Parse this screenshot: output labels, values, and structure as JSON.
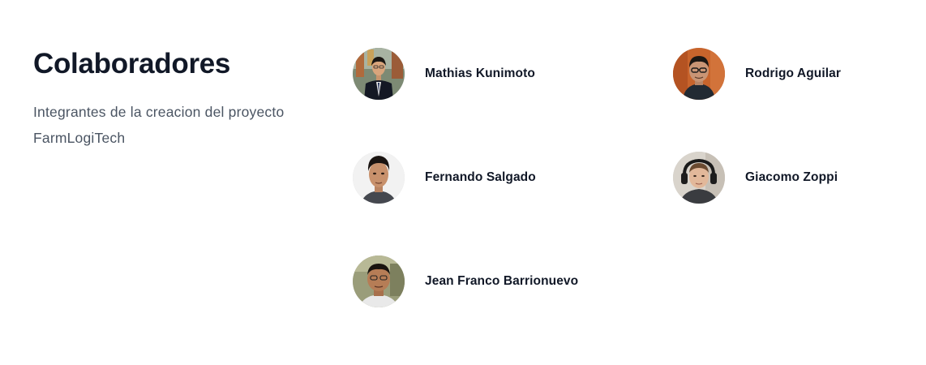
{
  "section": {
    "title": "Colaboradores",
    "description": "Integrantes de la creacion del proyecto FarmLogiTech"
  },
  "members": [
    {
      "name": "Mathias Kunimoto",
      "avatar_icon": "user-photo-avatar"
    },
    {
      "name": "Rodrigo Aguilar",
      "avatar_icon": "user-photo-avatar"
    },
    {
      "name": "Fernando Salgado",
      "avatar_icon": "user-photo-avatar"
    },
    {
      "name": "Giacomo Zoppi",
      "avatar_icon": "user-photo-avatar"
    },
    {
      "name": "Jean Franco Barrionuevo",
      "avatar_icon": "user-photo-avatar"
    }
  ]
}
